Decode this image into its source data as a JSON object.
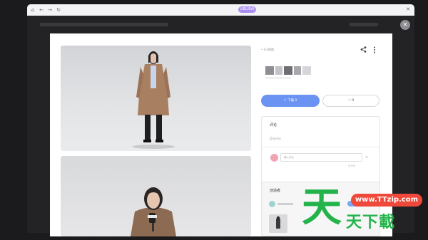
{
  "browser": {
    "nav_home": "⌂",
    "nav_back": "←",
    "nav_forward": "→",
    "nav_refresh": "↻",
    "tab_pill": "LIBLIBAI",
    "window_close": "✕"
  },
  "modal": {
    "close_glyph": "×",
    "meta_label": "• 1小时前",
    "download_label": "⇩ 下载 0",
    "like_label": "♡ 0",
    "comments": {
      "title": "评论",
      "empty_hint": "暂无评论",
      "input_placeholder": "输入评论",
      "counter": "0/300",
      "send_glyph": "➤"
    },
    "creator": {
      "title": "创造者"
    }
  },
  "watermark": {
    "big_char": "天",
    "row_text": "天下載",
    "url": "www.TTzip.com"
  },
  "colors": {
    "accent": "#6b93f2",
    "watermark_green": "#23b34a",
    "watermark_red": "#f0493b",
    "pill_purple": "#a98ef2"
  }
}
